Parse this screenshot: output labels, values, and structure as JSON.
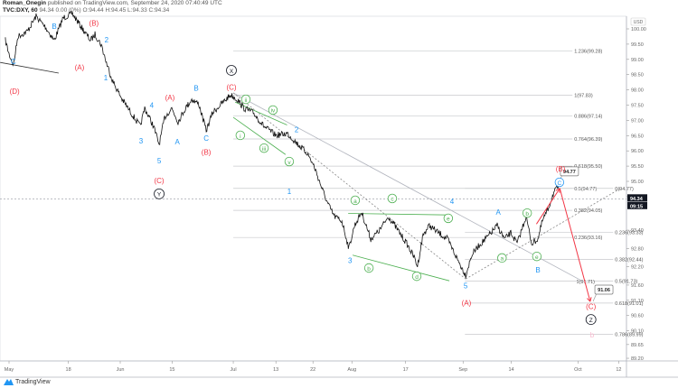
{
  "header": {
    "author": "Roman_Onegin",
    "published": "published on TradingView.com, September 24, 2020 07:40:49 UTC",
    "symbol": "TVC:DXY, 60",
    "quote": "94.34 0.00 (0%) O:94.44 H:94.45 L:94.33 C:94.34"
  },
  "footer": {
    "brand": "TradingView"
  },
  "colors": {
    "red": "#f23645",
    "blue": "#2196f3",
    "green": "#4caf50",
    "black": "#131722",
    "pink": "#f8bbd0",
    "grey": "#b2b5be"
  },
  "chart_data": {
    "type": "line",
    "title": "TVC:DXY, 60",
    "currency": "USD",
    "last_price": "94.34",
    "countdown": "09:15",
    "yticks": [
      "100.00",
      "99.50",
      "99.00",
      "98.50",
      "98.00",
      "97.50",
      "97.00",
      "96.50",
      "96.00",
      "95.50",
      "95.00",
      "94.50",
      "93.40",
      "92.80",
      "92.20",
      "91.60",
      "91.10",
      "90.60",
      "90.10",
      "89.65",
      "89.20"
    ],
    "xticks": [
      {
        "label": "May",
        "day": 0
      },
      {
        "label": "18",
        "day": 16
      },
      {
        "label": "Jun",
        "day": 30
      },
      {
        "label": "15",
        "day": 44
      },
      {
        "label": "Jul",
        "day": 60.5
      },
      {
        "label": "13",
        "day": 72
      },
      {
        "label": "22",
        "day": 82
      },
      {
        "label": "Aug",
        "day": 92.5
      },
      {
        "label": "17",
        "day": 107
      },
      {
        "label": "Sep",
        "day": 122.5
      },
      {
        "label": "14",
        "day": 135.5
      },
      {
        "label": "Oct",
        "day": 153.5
      },
      {
        "label": "12",
        "day": 164.5
      }
    ],
    "price_series": [
      [
        -1,
        99.62
      ],
      [
        0,
        99.17
      ],
      [
        1.2,
        98.82
      ],
      [
        2.4,
        99.76
      ],
      [
        4.9,
        99.91
      ],
      [
        7.3,
        100.41
      ],
      [
        9.8,
        100.06
      ],
      [
        12.2,
        99.62
      ],
      [
        14.6,
        100.36
      ],
      [
        17.1,
        100.5
      ],
      [
        19.5,
        100.06
      ],
      [
        22,
        99.62
      ],
      [
        23.2,
        99.82
      ],
      [
        24.9,
        99.47
      ],
      [
        26.3,
        98.88
      ],
      [
        28,
        98.28
      ],
      [
        30.5,
        97.69
      ],
      [
        32.9,
        97.25
      ],
      [
        35.4,
        96.8
      ],
      [
        36.6,
        97.4
      ],
      [
        37.8,
        97.1
      ],
      [
        39,
        96.8
      ],
      [
        40.5,
        96.21
      ],
      [
        42,
        97.1
      ],
      [
        43.9,
        97.4
      ],
      [
        45.6,
        96.95
      ],
      [
        47.6,
        97.4
      ],
      [
        49.3,
        97.69
      ],
      [
        51.2,
        97.54
      ],
      [
        53.2,
        96.66
      ],
      [
        54.9,
        97.25
      ],
      [
        57.3,
        97.54
      ],
      [
        59.8,
        97.84
      ],
      [
        61.5,
        97.69
      ],
      [
        63.4,
        97.4
      ],
      [
        65.9,
        97.25
      ],
      [
        68.8,
        96.8
      ],
      [
        72,
        96.51
      ],
      [
        75.1,
        96.57
      ],
      [
        78,
        96.21
      ],
      [
        80.5,
        95.92
      ],
      [
        82.4,
        95.47
      ],
      [
        84.1,
        94.88
      ],
      [
        85.9,
        94.29
      ],
      [
        87.8,
        93.85
      ],
      [
        89.8,
        93.7
      ],
      [
        91.7,
        92.81
      ],
      [
        93.2,
        93.55
      ],
      [
        95.1,
        93.99
      ],
      [
        97.6,
        93.11
      ],
      [
        100,
        93.4
      ],
      [
        102.4,
        93.85
      ],
      [
        104.9,
        93.4
      ],
      [
        107.3,
        92.96
      ],
      [
        109.3,
        92.51
      ],
      [
        110.2,
        92.22
      ],
      [
        111.7,
        93.25
      ],
      [
        113.4,
        93.55
      ],
      [
        115.9,
        93.31
      ],
      [
        118.3,
        93.11
      ],
      [
        120.7,
        92.51
      ],
      [
        123.2,
        91.92
      ],
      [
        124.9,
        92.6
      ],
      [
        126.8,
        92.9
      ],
      [
        129.3,
        93.2
      ],
      [
        131.7,
        93.55
      ],
      [
        133.7,
        93.11
      ],
      [
        135.4,
        93.31
      ],
      [
        137.1,
        92.96
      ],
      [
        139.5,
        93.85
      ],
      [
        141,
        92.96
      ],
      [
        142.7,
        93.11
      ],
      [
        143.9,
        93.7
      ],
      [
        145.4,
        94.08
      ],
      [
        146.8,
        94.59
      ],
      [
        148.3,
        94.85
      ]
    ],
    "fib_sets": [
      {
        "from_day": 60.5,
        "to_day": 152,
        "levels": [
          {
            "label": "1.236(99.28)",
            "price": 99.28
          },
          {
            "label": "1(97.83)",
            "price": 97.83
          },
          {
            "label": "0.886(97.14)",
            "price": 97.14
          },
          {
            "label": "0.764(96.39)",
            "price": 96.39
          },
          {
            "label": "0.618(95.50)",
            "price": 95.5
          },
          {
            "label": "0.5(94.77)",
            "price": 94.77
          },
          {
            "label": "0.382(94.05)",
            "price": 94.05
          },
          {
            "label": "0.236(93.16)",
            "price": 93.16
          }
        ]
      },
      {
        "from_day": 123,
        "to_day": 163,
        "levels": [
          {
            "label": "0(94.77)",
            "price": 94.77
          },
          {
            "label": "0.236(93.33)",
            "price": 93.33
          },
          {
            "label": "0.382(92.44)",
            "price": 92.44
          },
          {
            "label": "0.5(91.73)",
            "price": 91.73
          },
          {
            "label": "0.618(91.01)",
            "price": 91.01
          },
          {
            "label": "0.786(89.99)",
            "price": 89.99
          }
        ]
      }
    ],
    "extra_label": {
      "label": "1(91.71)",
      "price": 91.71,
      "day": 155
    },
    "callouts": [
      {
        "label": "94.77",
        "day": 151.2,
        "price": 95.33
      },
      {
        "label": "91.06",
        "day": 160.5,
        "price": 91.45
      }
    ],
    "wave_labels": [
      {
        "t": "C",
        "c": "blue",
        "d": 1.2,
        "p": 98.93
      },
      {
        "t": "(D)",
        "c": "red",
        "d": 1.5,
        "p": 97.96
      },
      {
        "t": "B",
        "c": "blue",
        "d": 12.2,
        "p": 100.09
      },
      {
        "t": "(B)",
        "c": "red",
        "d": 22.9,
        "p": 100.18
      },
      {
        "t": "(A)",
        "c": "red",
        "d": 19,
        "p": 98.73
      },
      {
        "t": "2",
        "c": "blue",
        "d": 26.3,
        "p": 99.64
      },
      {
        "t": "1",
        "c": "blue",
        "d": 26.1,
        "p": 98.4
      },
      {
        "t": "4",
        "c": "blue",
        "d": 38.5,
        "p": 97.49
      },
      {
        "t": "3",
        "c": "blue",
        "d": 35.6,
        "p": 96.33
      },
      {
        "t": "5",
        "c": "blue",
        "d": 40.5,
        "p": 95.68
      },
      {
        "t": "A",
        "c": "blue",
        "d": 45.4,
        "p": 96.3
      },
      {
        "t": "B",
        "c": "blue",
        "d": 50.5,
        "p": 98.05
      },
      {
        "t": "C",
        "c": "blue",
        "d": 53.2,
        "p": 96.42
      },
      {
        "t": "(A)",
        "c": "red",
        "d": 43.4,
        "p": 97.75
      },
      {
        "t": "(B)",
        "c": "red",
        "d": 53.2,
        "p": 95.95
      },
      {
        "t": "(C)",
        "c": "red",
        "d": 60,
        "p": 98.08
      },
      {
        "t": "(C)",
        "c": "red",
        "d": 40.5,
        "p": 95.03
      },
      {
        "t": "Y",
        "c": "black",
        "circle": true,
        "d": 40.5,
        "p": 94.59
      },
      {
        "t": "X",
        "c": "black",
        "circle": true,
        "d": 60,
        "p": 98.64
      },
      {
        "t": "1",
        "c": "blue",
        "d": 75.6,
        "p": 94.67
      },
      {
        "t": "ii",
        "c": "green",
        "circle": true,
        "d": 63.9,
        "p": 97.69
      },
      {
        "t": "iv",
        "c": "green",
        "circle": true,
        "d": 71.2,
        "p": 97.34
      },
      {
        "t": "i",
        "c": "green",
        "circle": true,
        "d": 62.4,
        "p": 96.51
      },
      {
        "t": "iii",
        "c": "green",
        "circle": true,
        "d": 68.8,
        "p": 96.09
      },
      {
        "t": "v",
        "c": "green",
        "circle": true,
        "d": 75.6,
        "p": 95.65
      },
      {
        "t": "2",
        "c": "blue",
        "d": 77.6,
        "p": 96.69
      },
      {
        "t": "a",
        "c": "green",
        "circle": true,
        "d": 93.4,
        "p": 94.38
      },
      {
        "t": "c",
        "c": "green",
        "circle": true,
        "d": 103.4,
        "p": 94.44
      },
      {
        "t": "4",
        "c": "blue",
        "d": 119.5,
        "p": 94.35
      },
      {
        "t": "e",
        "c": "green",
        "circle": true,
        "d": 118.5,
        "p": 93.79
      },
      {
        "t": "b",
        "c": "green",
        "circle": true,
        "d": 97.1,
        "p": 92.16
      },
      {
        "t": "d",
        "c": "green",
        "circle": true,
        "d": 110,
        "p": 91.89
      },
      {
        "t": "3",
        "c": "blue",
        "d": 92,
        "p": 92.4
      },
      {
        "t": "5",
        "c": "blue",
        "d": 123.2,
        "p": 91.57
      },
      {
        "t": "(A)",
        "c": "red",
        "d": 123.4,
        "p": 91.01
      },
      {
        "t": "A",
        "c": "blue",
        "d": 132,
        "p": 93.99
      },
      {
        "t": "b",
        "c": "green",
        "circle": true,
        "d": 139.8,
        "p": 93.96
      },
      {
        "t": "a",
        "c": "green",
        "circle": true,
        "d": 133,
        "p": 92.49
      },
      {
        "t": "e",
        "c": "green",
        "circle": true,
        "d": 142.4,
        "p": 92.54
      },
      {
        "t": "B",
        "c": "blue",
        "d": 142.7,
        "p": 92.1
      },
      {
        "t": "C",
        "c": "blue",
        "circle": true,
        "d": 148.5,
        "p": 94.97
      },
      {
        "t": "(B)",
        "c": "red",
        "d": 148.8,
        "p": 95.41
      },
      {
        "t": "(C)",
        "c": "red",
        "d": 157,
        "p": 90.89
      },
      {
        "t": "Z",
        "c": "black",
        "circle": true,
        "d": 157,
        "p": 90.47
      },
      {
        "t": "b",
        "c": "pink",
        "d": 157.3,
        "p": 89.97
      }
    ]
  }
}
